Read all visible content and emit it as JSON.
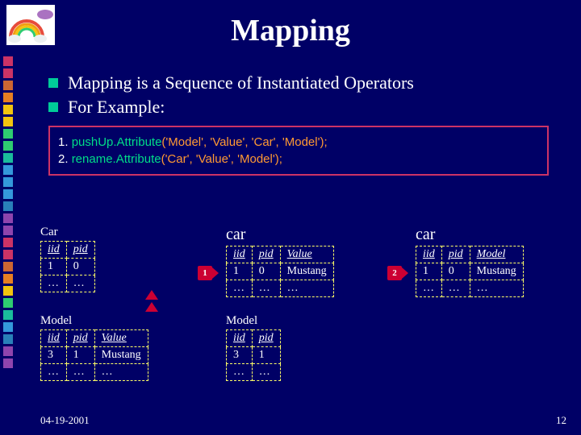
{
  "title": "Mapping",
  "bullets": [
    "Mapping is a Sequence of Instantiated Operators",
    "For Example:"
  ],
  "code": {
    "l1_num": "1. ",
    "l1_fn": "pushUp.Attribute",
    "l1_args": "('Model', 'Value', 'Car', 'Model');",
    "l2_num": "2. ",
    "l2_fn": "rename.Attribute",
    "l2_args": "('Car', 'Value', 'Model');"
  },
  "step_badges": {
    "one": "1",
    "two": "2"
  },
  "tables": {
    "car_initial": {
      "title": "Car",
      "headers": [
        "iid",
        "pid"
      ],
      "rows": [
        [
          "1",
          "0"
        ],
        [
          "…",
          "…"
        ]
      ]
    },
    "model_initial": {
      "title": "Model",
      "headers": [
        "iid",
        "pid",
        "Value"
      ],
      "rows": [
        [
          "3",
          "1",
          "Mustang"
        ],
        [
          "…",
          "…",
          "…"
        ]
      ]
    },
    "car_mid": {
      "title": "car",
      "headers": [
        "iid",
        "pid",
        "Value"
      ],
      "rows": [
        [
          "1",
          "0",
          "Mustang"
        ],
        [
          "…",
          "…",
          "…"
        ]
      ]
    },
    "model_mid": {
      "title": "Model",
      "headers": [
        "iid",
        "pid"
      ],
      "rows": [
        [
          "3",
          "1"
        ],
        [
          "…",
          "…"
        ]
      ]
    },
    "car_final": {
      "title": "car",
      "headers": [
        "iid",
        "pid",
        "Model"
      ],
      "rows": [
        [
          "1",
          "0",
          "Mustang"
        ],
        [
          "…",
          "…",
          "…"
        ]
      ]
    }
  },
  "footer": {
    "date": "04-19-2001",
    "page": "12"
  },
  "side_colors": [
    "#cc3366",
    "#cc3366",
    "#cc6633",
    "#e67e22",
    "#f1c40f",
    "#f1c40f",
    "#2ecc71",
    "#2ecc71",
    "#1abc9c",
    "#3498db",
    "#3498db",
    "#3498db",
    "#2980b9",
    "#8e44ad",
    "#8e44ad",
    "#cc3366",
    "#cc3366",
    "#cc6633",
    "#e67e22",
    "#f1c40f",
    "#2ecc71",
    "#1abc9c",
    "#3498db",
    "#2980b9",
    "#8e44ad",
    "#8e44ad"
  ]
}
